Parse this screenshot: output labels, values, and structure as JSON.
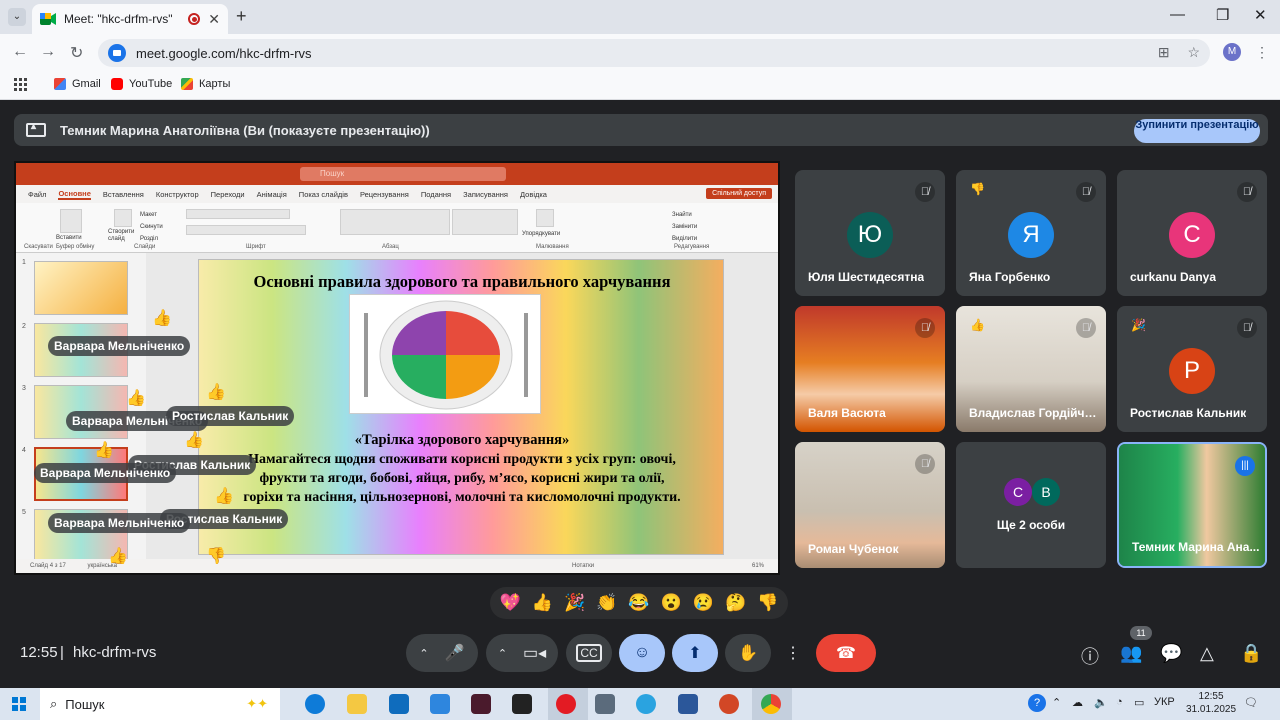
{
  "browser": {
    "tab_title": "Meet: \"hkc-drfm-rvs\"",
    "url": "meet.google.com/hkc-drfm-rvs",
    "profile_initial": "M",
    "bookmarks": [
      {
        "label": "Gmail",
        "icon": "gmail-icon"
      },
      {
        "label": "YouTube",
        "icon": "youtube-icon"
      },
      {
        "label": "Карты",
        "icon": "maps-icon"
      }
    ]
  },
  "presenting_bar": {
    "text": "Темник Марина Анатоліївна (Ви (показуєте презентацію))",
    "stop_label": "Зупинити презентацію"
  },
  "powerpoint": {
    "menu": [
      "Файл",
      "Основне",
      "Вставлення",
      "Конструктор",
      "Переходи",
      "Анімація",
      "Показ слайдів",
      "Рецензування",
      "Подання",
      "Записування",
      "Довідка"
    ],
    "share_label": "Спільний доступ",
    "search_placeholder": "Пошук",
    "ribbon_groups": [
      "Скасувати",
      "Буфер обміну",
      "Слайди",
      "Шрифт",
      "Абзац",
      "Малювання",
      "Редагування"
    ],
    "ribbon_items": {
      "paste": "Вставити",
      "new_slide": "Створити слайд",
      "layout": "Макет",
      "reset": "Скинути",
      "section": "Розділ",
      "arrange": "Упорядкувати",
      "find": "Знайти",
      "replace": "Замінити",
      "select": "Виділити"
    },
    "slide_numbers": [
      "1",
      "2",
      "3",
      "4",
      "5"
    ],
    "status": "Слайд 4 з 17",
    "status_lang": "українська",
    "status_notes": "Нотатки",
    "zoom": "61%",
    "slide": {
      "title": "Основні правила здорового та правильного харчування",
      "subtitle": "«Тарілка здорового харчування»",
      "body": "Намагайтеся щодня споживати корисні продукти з усіх груп: овочі, фрукти та ягоди, бобові, яйця, рибу, м’ясо, корисні жири та олії, горіхи та насіння, цільнозернові, молочні та кисломолочні продукти."
    }
  },
  "reaction_chips": [
    "Варвара Мельніченко",
    "Варвара Мельніченко",
    "Варвара Мельніченко",
    "Варвара Мельніченко",
    "Ростислав Кальник",
    "Ростислав Кальник",
    "Ростислав Кальник"
  ],
  "participants": [
    {
      "name": "Юля Шестидесятна",
      "initial": "Ю",
      "color": "#0b5e57",
      "muted": true
    },
    {
      "name": "Яна Горбенко",
      "initial": "Я",
      "color": "#1e88e5",
      "muted": true,
      "reaction": "👎"
    },
    {
      "name": "curkanu Danya",
      "initial": "C",
      "color": "#e8357a",
      "muted": true
    },
    {
      "name": "Валя Васюта",
      "muted": true,
      "video": true
    },
    {
      "name": "Владислав Гордійче...",
      "muted": true,
      "video": true,
      "reaction": "👍"
    },
    {
      "name": "Ростислав Кальник",
      "initial": "Р",
      "color": "#d84315",
      "muted": true,
      "reaction": "🎉"
    },
    {
      "name": "Роман Чубенок",
      "muted": true,
      "video": true
    },
    {
      "name": "Ще 2 особи",
      "initials": [
        "C",
        "B"
      ],
      "colors": [
        "#7b1fa2",
        "#00695c"
      ]
    },
    {
      "name": "Темник Марина Ана...",
      "video": true,
      "speaking": true
    }
  ],
  "reactions": [
    "💖",
    "👍",
    "🎉",
    "👏",
    "😂",
    "😮",
    "😢",
    "🤔",
    "👎"
  ],
  "controls": {
    "time": "12:55",
    "meeting_code": "hkc-drfm-rvs",
    "participants_count": "11"
  },
  "taskbar": {
    "search_label": "Пошук",
    "lang": "УКР",
    "time": "12:55",
    "date": "31.01.2025"
  }
}
